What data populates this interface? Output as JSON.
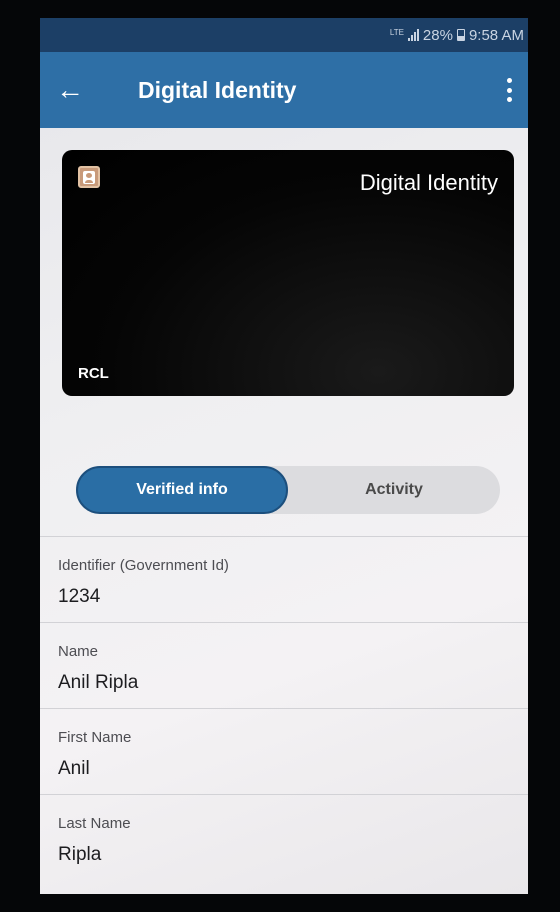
{
  "status_bar": {
    "network": "LTE",
    "battery": "28%",
    "time": "9:58 AM"
  },
  "app_bar": {
    "title": "Digital Identity",
    "back_icon": "arrow-left-icon",
    "menu_icon": "more-vert-icon"
  },
  "card": {
    "title": "Digital Identity",
    "footer": "RCL",
    "icon": "contact-card-icon"
  },
  "tabs": [
    {
      "label": "Verified info",
      "selected": true
    },
    {
      "label": "Activity",
      "selected": false
    }
  ],
  "info": [
    {
      "label": "Identifier (Government Id)",
      "value": "1234"
    },
    {
      "label": "Name",
      "value": "Anil Ripla"
    },
    {
      "label": "First Name",
      "value": "Anil"
    },
    {
      "label": "Last Name",
      "value": "Ripla"
    }
  ],
  "colors": {
    "app_bar": "#2e6fa6",
    "status_bar": "#1c3f66",
    "tab_selected": "#2a6ea5"
  }
}
